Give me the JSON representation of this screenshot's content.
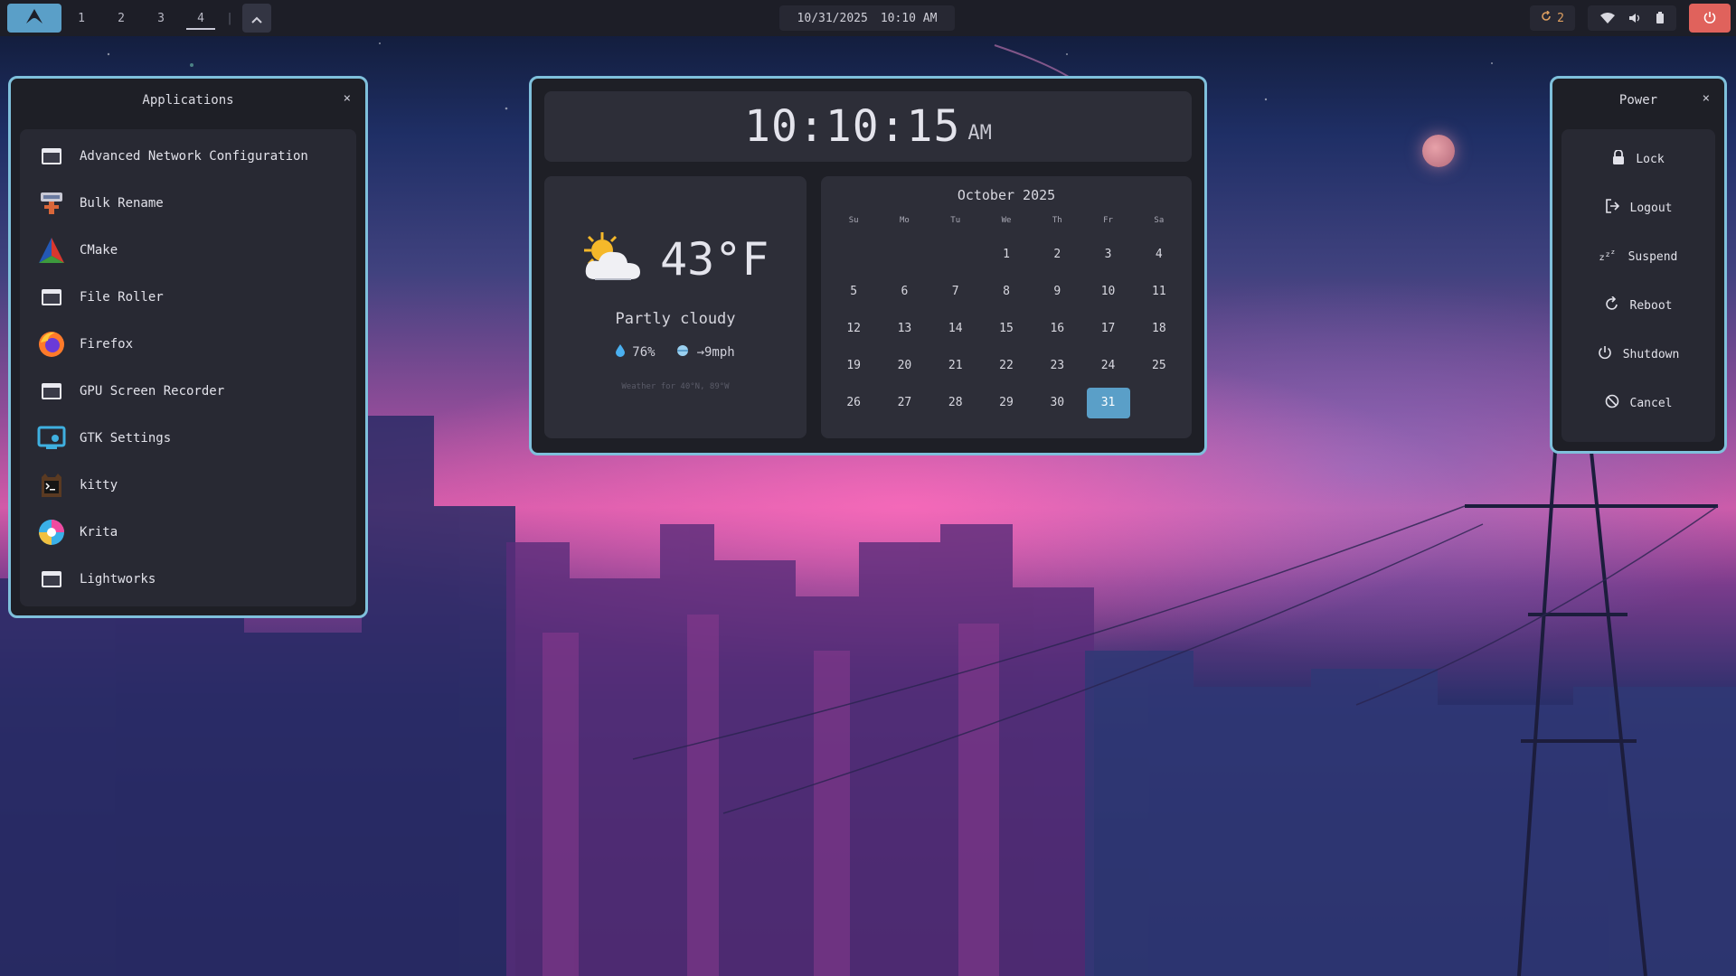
{
  "topbar": {
    "workspaces": [
      "1",
      "2",
      "3",
      "4"
    ],
    "active_workspace": "4",
    "separator": "|",
    "date": "10/31/2025",
    "time": "10:10 AM",
    "updates_count": "2"
  },
  "apps_panel": {
    "title": "Applications",
    "close": "×",
    "items": [
      {
        "label": "Advanced Network Configuration",
        "icon": "window-icon"
      },
      {
        "label": "Bulk Rename",
        "icon": "bulk-rename-icon"
      },
      {
        "label": "CMake",
        "icon": "cmake-icon"
      },
      {
        "label": "File Roller",
        "icon": "window-icon"
      },
      {
        "label": "Firefox",
        "icon": "firefox-icon"
      },
      {
        "label": "GPU Screen Recorder",
        "icon": "window-icon"
      },
      {
        "label": "GTK Settings",
        "icon": "gtk-settings-icon"
      },
      {
        "label": "kitty",
        "icon": "kitty-icon"
      },
      {
        "label": "Krita",
        "icon": "krita-icon"
      },
      {
        "label": "Lightworks",
        "icon": "window-icon"
      }
    ]
  },
  "clock": {
    "time": "10:10:15",
    "ampm": "AM"
  },
  "weather": {
    "temp": "43°F",
    "condition": "Partly cloudy",
    "humidity": "76%",
    "wind": "→9mph",
    "note": "Weather for 40°N, 89°W"
  },
  "calendar": {
    "title": "October 2025",
    "weekdays": [
      "Su",
      "Mo",
      "Tu",
      "We",
      "Th",
      "Fr",
      "Sa"
    ],
    "days": [
      "",
      "",
      "",
      "1",
      "2",
      "3",
      "4",
      "5",
      "6",
      "7",
      "8",
      "9",
      "10",
      "11",
      "12",
      "13",
      "14",
      "15",
      "16",
      "17",
      "18",
      "19",
      "20",
      "21",
      "22",
      "23",
      "24",
      "25",
      "26",
      "27",
      "28",
      "29",
      "30",
      "31",
      ""
    ],
    "today": "31"
  },
  "power_panel": {
    "title": "Power",
    "close": "×",
    "items": [
      {
        "label": "Lock",
        "icon": "lock-icon"
      },
      {
        "label": "Logout",
        "icon": "logout-icon"
      },
      {
        "label": "Suspend",
        "icon": "suspend-icon"
      },
      {
        "label": "Reboot",
        "icon": "reboot-icon"
      },
      {
        "label": "Shutdown",
        "icon": "shutdown-icon"
      },
      {
        "label": "Cancel",
        "icon": "cancel-icon"
      }
    ]
  },
  "colors": {
    "accent": "#5a9fc8",
    "border": "#7fc0dc",
    "power_button": "#e0625c",
    "panel_bg": "#1e1f26"
  }
}
